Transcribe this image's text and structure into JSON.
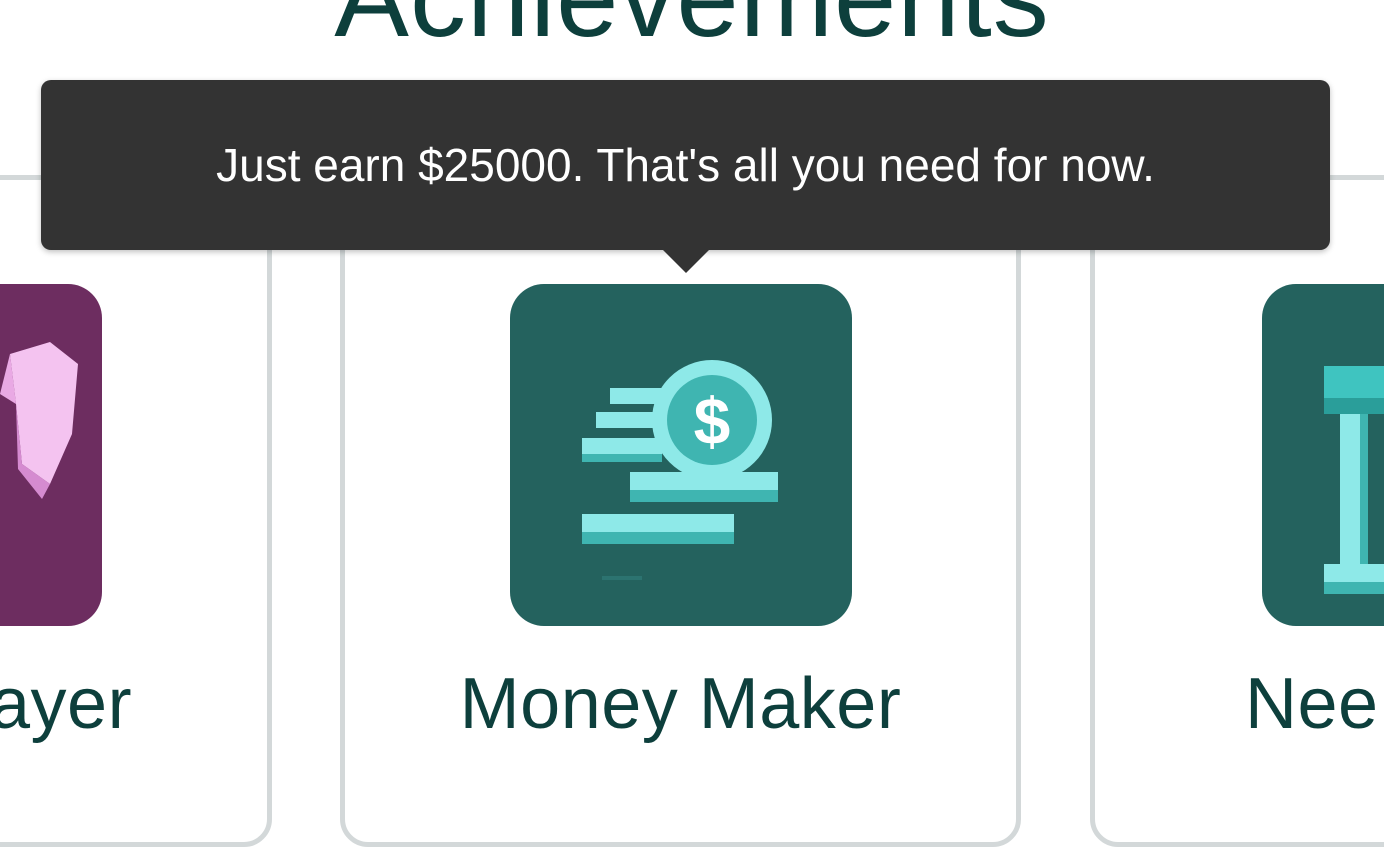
{
  "page": {
    "title": "Achievements"
  },
  "achievements": [
    {
      "label": "ayer",
      "icon": "gem-icon",
      "tile_color": "#6d2d60"
    },
    {
      "label": "Money Maker",
      "icon": "coin-stack-icon",
      "tile_color": "#24625e"
    },
    {
      "label": "Nee",
      "icon": "bank-icon",
      "tile_color": "#24625e"
    }
  ],
  "tooltip": {
    "text": "Just earn $25000. That's all you need for now."
  },
  "colors": {
    "title": "#0d3f3c",
    "tooltip_bg": "#333333",
    "card_border": "#d3d8d9",
    "icon_accent": "#8ee9e8",
    "icon_dark_accent": "#3fb5b1"
  }
}
